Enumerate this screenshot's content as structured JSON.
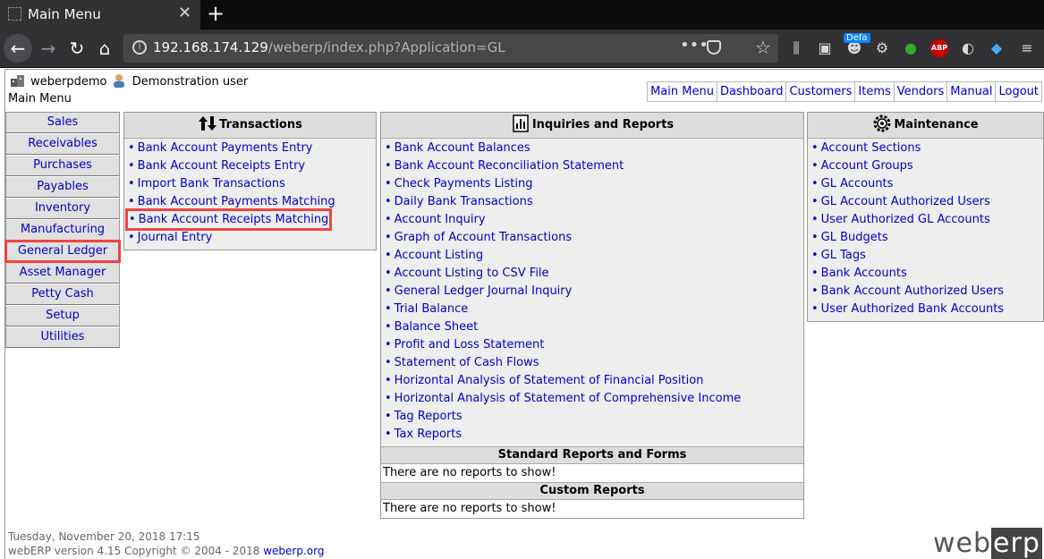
{
  "browser": {
    "tab_title": "Main Menu",
    "url_host": "192.168.174.129",
    "url_path": "/weberp/index.php?Application=GL",
    "ext_badge": "Defa"
  },
  "user": {
    "username": "weberpdemo",
    "realname": "Demonstration user"
  },
  "page_title": "Main Menu",
  "top_menu": [
    "Main Menu",
    "Dashboard",
    "Customers",
    "Items",
    "Vendors",
    "Manual",
    "Logout"
  ],
  "modules": [
    "Sales",
    "Receivables",
    "Purchases",
    "Payables",
    "Inventory",
    "Manufacturing",
    "General Ledger",
    "Asset Manager",
    "Petty Cash",
    "Setup",
    "Utilities"
  ],
  "active_module": "General Ledger",
  "transactions": {
    "title": "Transactions",
    "items": [
      "Bank Account Payments Entry",
      "Bank Account Receipts Entry",
      "Import Bank Transactions",
      "Bank Account Payments Matching",
      "Bank Account Receipts Matching",
      "Journal Entry"
    ]
  },
  "inquiries": {
    "title": "Inquiries and Reports",
    "items": [
      "Bank Account Balances",
      "Bank Account Reconciliation Statement",
      "Check Payments Listing",
      "Daily Bank Transactions",
      "Account Inquiry",
      "Graph of Account Transactions",
      "Account Listing",
      "Account Listing to CSV File",
      "General Ledger Journal Inquiry",
      "Trial Balance",
      "Balance Sheet",
      "Profit and Loss Statement",
      "Statement of Cash Flows",
      "Horizontal Analysis of Statement of Financial Position",
      "Horizontal Analysis of Statement of Comprehensive Income",
      "Tag Reports",
      "Tax Reports"
    ],
    "standard_title": "Standard Reports and Forms",
    "standard_empty": "There are no reports to show!",
    "custom_title": "Custom Reports",
    "custom_empty": "There are no reports to show!"
  },
  "maintenance": {
    "title": "Maintenance",
    "items": [
      "Account Sections",
      "Account Groups",
      "GL Accounts",
      "GL Account Authorized Users",
      "User Authorized GL Accounts",
      "GL Budgets",
      "GL Tags",
      "Bank Accounts",
      "Bank Account Authorized Users",
      "User Authorized Bank Accounts"
    ]
  },
  "footer": {
    "datetime": "Tuesday, November 20, 2018 17:15",
    "version": "webERP version 4.15 Copyright © 2004 - 2018",
    "site_link": "weberp.org",
    "logo_left": "web",
    "logo_right": "erp"
  },
  "colors": {
    "link": "#0000cc",
    "highlight": "#ee4444",
    "panel_bg": "#eeeeee"
  }
}
